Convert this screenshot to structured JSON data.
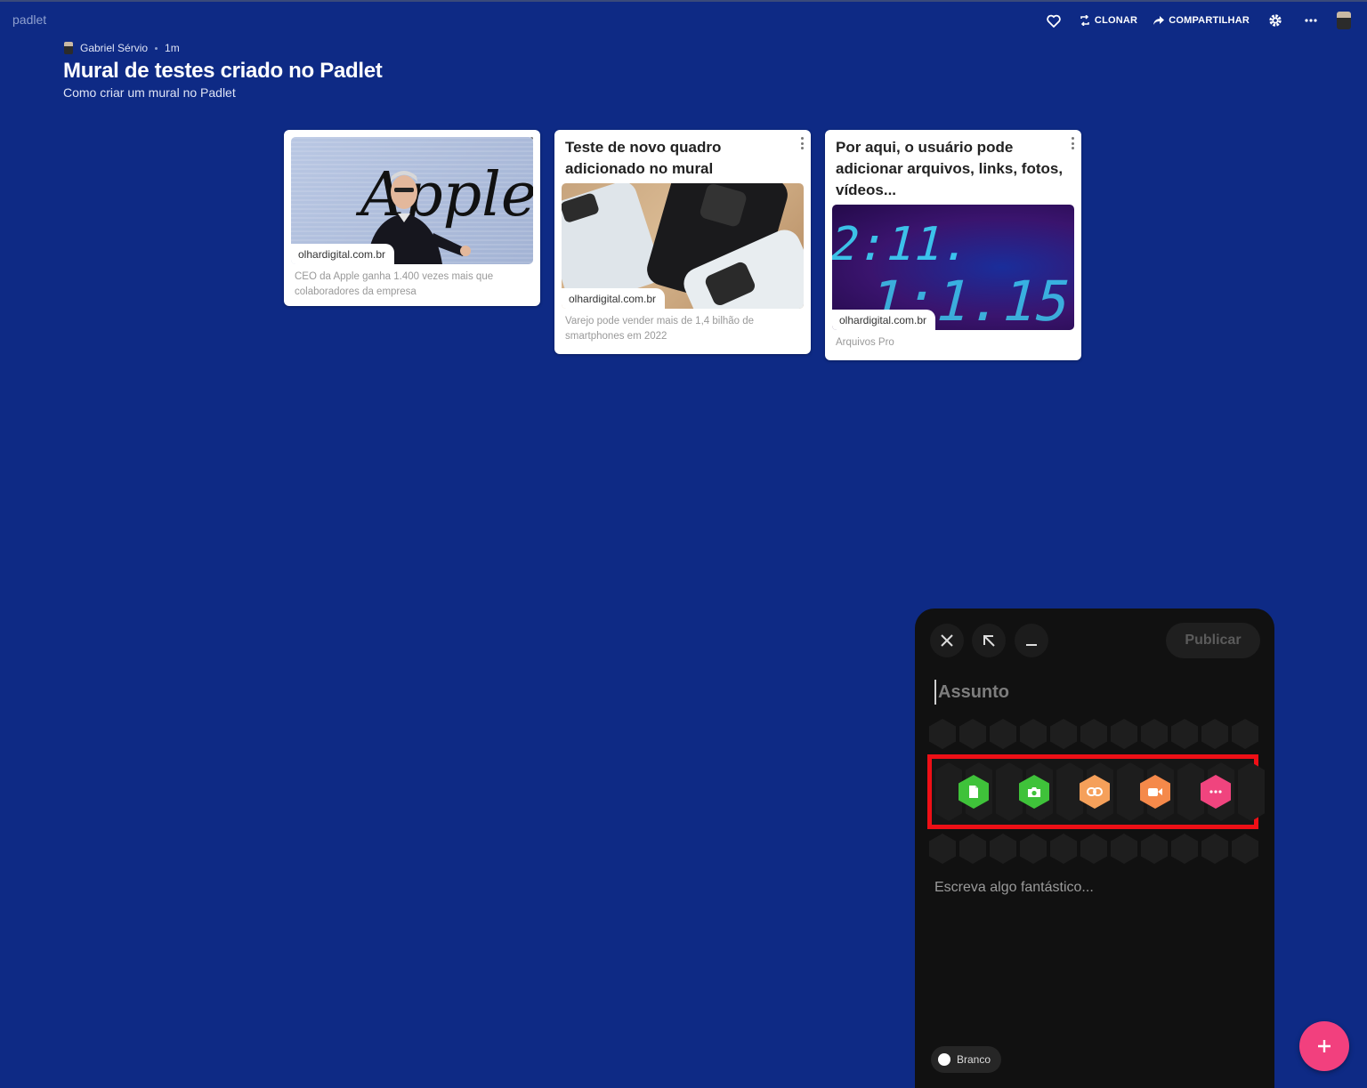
{
  "app": {
    "brand": "padlet"
  },
  "topbar": {
    "clone_label": "CLONAR",
    "share_label": "COMPARTILHAR",
    "icons": [
      "heart-icon",
      "clone-icon",
      "share-icon",
      "gear-icon",
      "more-icon"
    ]
  },
  "board": {
    "author": "Gabriel Sérvio",
    "time": "1m",
    "title": "Mural de testes criado no Padlet",
    "subtitle": "Como criar um mural no Padlet"
  },
  "posts": [
    {
      "title": "",
      "image_text": "Apple",
      "domain": "olhardigital.com.br",
      "description": "CEO da Apple ganha 1.400 vezes mais que colaboradores da empresa"
    },
    {
      "title": "Teste de novo quadro adicionado no mural",
      "domain": "olhardigital.com.br",
      "description": "Varejo pode vender mais de 1,4 bilhão de smartphones em 2022"
    },
    {
      "title": "Por aqui, o usuário pode adicionar arquivos, links, fotos, vídeos...",
      "image_text": "2:11.",
      "image_text_2": "1:1.15",
      "domain": "olhardigital.com.br",
      "description": "Arquivos Pro"
    }
  ],
  "composer": {
    "publish_label": "Publicar",
    "subject_placeholder": "Assunto",
    "body_placeholder": "Escreva algo fantástico...",
    "color_label": "Branco",
    "attachments": [
      {
        "name": "file-icon",
        "color": "#3fc23a"
      },
      {
        "name": "camera-icon",
        "color": "#3fc23a"
      },
      {
        "name": "link-icon",
        "color": "#f5a05a"
      },
      {
        "name": "video-icon",
        "color": "#f5894a"
      },
      {
        "name": "more-icon",
        "color": "#f0447e"
      }
    ]
  },
  "colors": {
    "background": "#0e2a85",
    "highlight": "#ee0f16",
    "fab": "#f2407e"
  }
}
